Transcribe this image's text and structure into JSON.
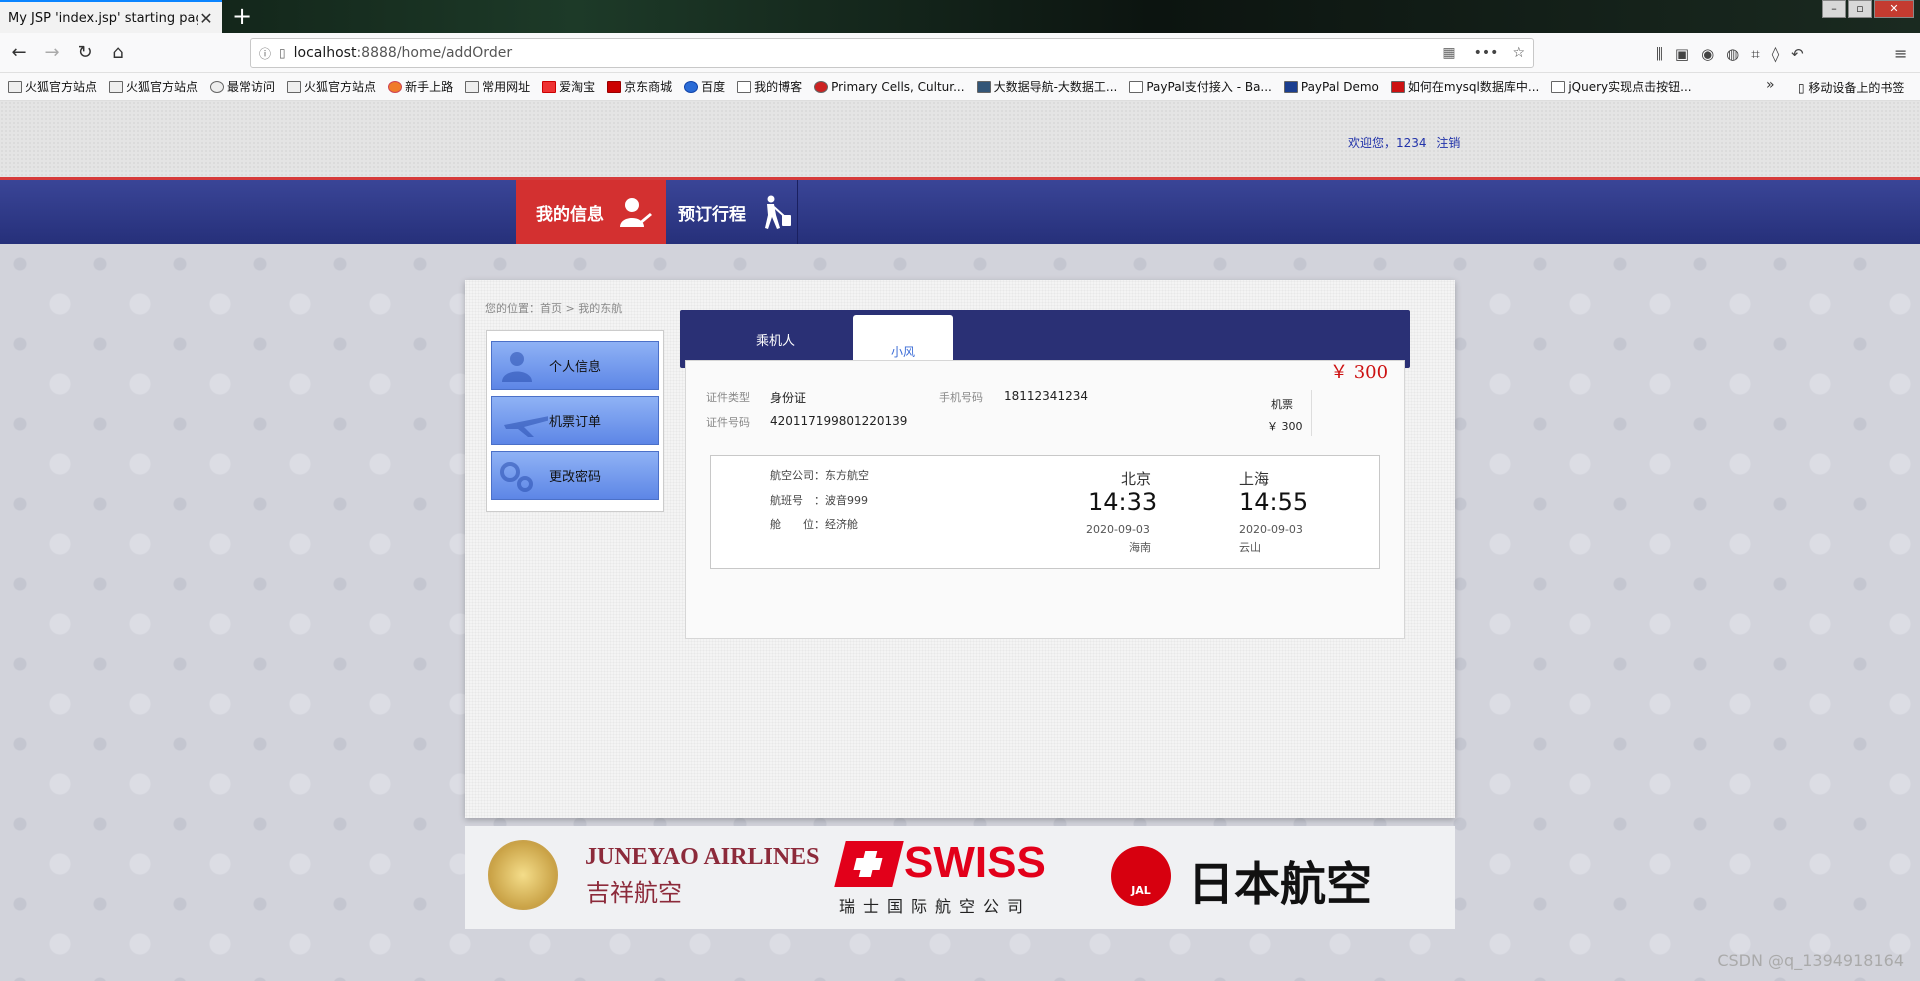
{
  "browser": {
    "tab_title": "My JSP 'index.jsp' starting page",
    "url_host": "localhost",
    "url_rest": ":8888/home/addOrder",
    "bookmarks": [
      "火狐官方站点",
      "火狐官方站点",
      "最常访问",
      "火狐官方站点",
      "新手上路",
      "常用网址",
      "爱淘宝",
      "京东商城",
      "百度",
      "我的博客",
      "Primary Cells, Cultur...",
      "大数据导航-大数据工...",
      "PayPal支付接入 - Ba...",
      "PayPal Demo",
      "如何在mysql数据库中...",
      "jQuery实现点击按钮..."
    ],
    "mobile_bookmarks": "移动设备上的书签"
  },
  "header": {
    "welcome": "欢迎您，1234",
    "logout": "注销"
  },
  "nav": {
    "my_info": "我的信息",
    "book_trip": "预订行程"
  },
  "breadcrumb": "您的位置：首页 > 我的东航",
  "sidebar": {
    "items": [
      {
        "label": "个人信息"
      },
      {
        "label": "机票订单"
      },
      {
        "label": "更改密码"
      }
    ]
  },
  "tabs": {
    "passenger": "乘机人",
    "name": "小风"
  },
  "price_top": "￥ 300",
  "passenger": {
    "id_type_label": "证件类型",
    "id_type": "身份证",
    "phone_label": "手机号码",
    "phone": "18112341234",
    "id_no_label": "证件号码",
    "id_no": "420117199801220139",
    "ticket_label": "机票",
    "ticket_price": "￥ 300"
  },
  "flight": {
    "airline": "航空公司：东方航空",
    "flight_no": "航班号　：波音999",
    "cabin": "舱　　位：经济舱",
    "from_city": "北京",
    "from_time": "14:33",
    "from_date": "2020-09-03",
    "from_airport": "海南",
    "to_city": "上海",
    "to_time": "14:55",
    "to_date": "2020-09-03",
    "to_airport": "云山"
  },
  "footer": {
    "juneyao_en": "JUNEYAO AIRLINES",
    "juneyao_cn": "吉祥航空",
    "swiss": "SWISS",
    "swiss_cn": "瑞士国际航空公司",
    "jal_cn": "日本航空",
    "jal": "JAL"
  },
  "watermark": "CSDN @q_1394918164"
}
